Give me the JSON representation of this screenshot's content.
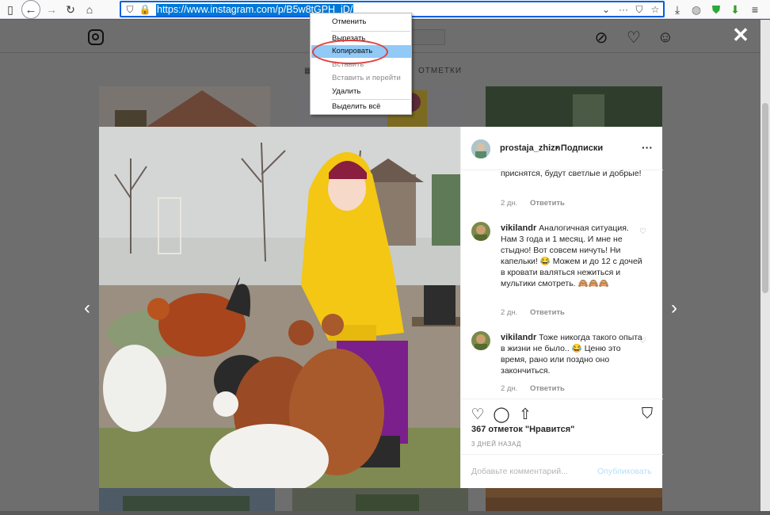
{
  "browser": {
    "url": "https://www.instagram.com/p/B5w8tGPH_iD/",
    "icons": [
      "sidebar-icon",
      "back-icon",
      "forward-icon",
      "reload-icon",
      "home-icon",
      "shield-icon",
      "lock-icon",
      "chevron-down-icon",
      "page-actions-icon",
      "pocket-icon",
      "bookmark-star-icon",
      "download-icon",
      "globe-icon",
      "shield-green-icon",
      "extension-icon"
    ]
  },
  "context_menu": {
    "items": [
      {
        "label": "Отменить",
        "enabled": true
      },
      {
        "label": "Вырезать",
        "enabled": true
      },
      {
        "label": "Копировать",
        "enabled": true,
        "highlighted": true
      },
      {
        "label": "Вставить",
        "enabled": false
      },
      {
        "label": "Вставить и перейти",
        "enabled": false
      },
      {
        "label": "Удалить",
        "enabled": true
      },
      {
        "label": "Выделить всё",
        "enabled": true
      }
    ]
  },
  "instagram": {
    "tabs_label": "ОТМЕТКИ"
  },
  "post": {
    "author": "prostaja_zhizn",
    "follow_label": "• Подписки",
    "comments": [
      {
        "user": "",
        "text": "приснятся, будут светлые и добрые!",
        "age": "2 дн.",
        "reply": "Ответить"
      },
      {
        "user": "vikilandr",
        "text": "Аналогичная ситуация. Нам 3 года и 1 месяц. И мне не стыдно! Вот совсем ничуть! Ни капельки! 😂 Можем и до 12 с дочей в кровати валяться нежиться и мультики смотреть. 🙈🙈🙈",
        "age": "2 дн.",
        "reply": "Ответить"
      },
      {
        "user": "vikilandr",
        "text": "Тоже никогда такого опыта в жизни не было.. 😂 Ценю это время, рано или поздно оно закончиться.",
        "age": "2 дн.",
        "reply": "Ответить"
      }
    ],
    "likes": "367 отметок \"Нравится\"",
    "time_ago": "3 дней назад",
    "comment_placeholder": "Добавьте комментарий...",
    "publish_label": "Опубликовать"
  },
  "colors": {
    "accent": "#0095f6",
    "menu_highlight": "#91c9f7",
    "annotation_ring": "#e0403d",
    "jacket": "#f3c714",
    "overlay": "#6e6e6e"
  }
}
